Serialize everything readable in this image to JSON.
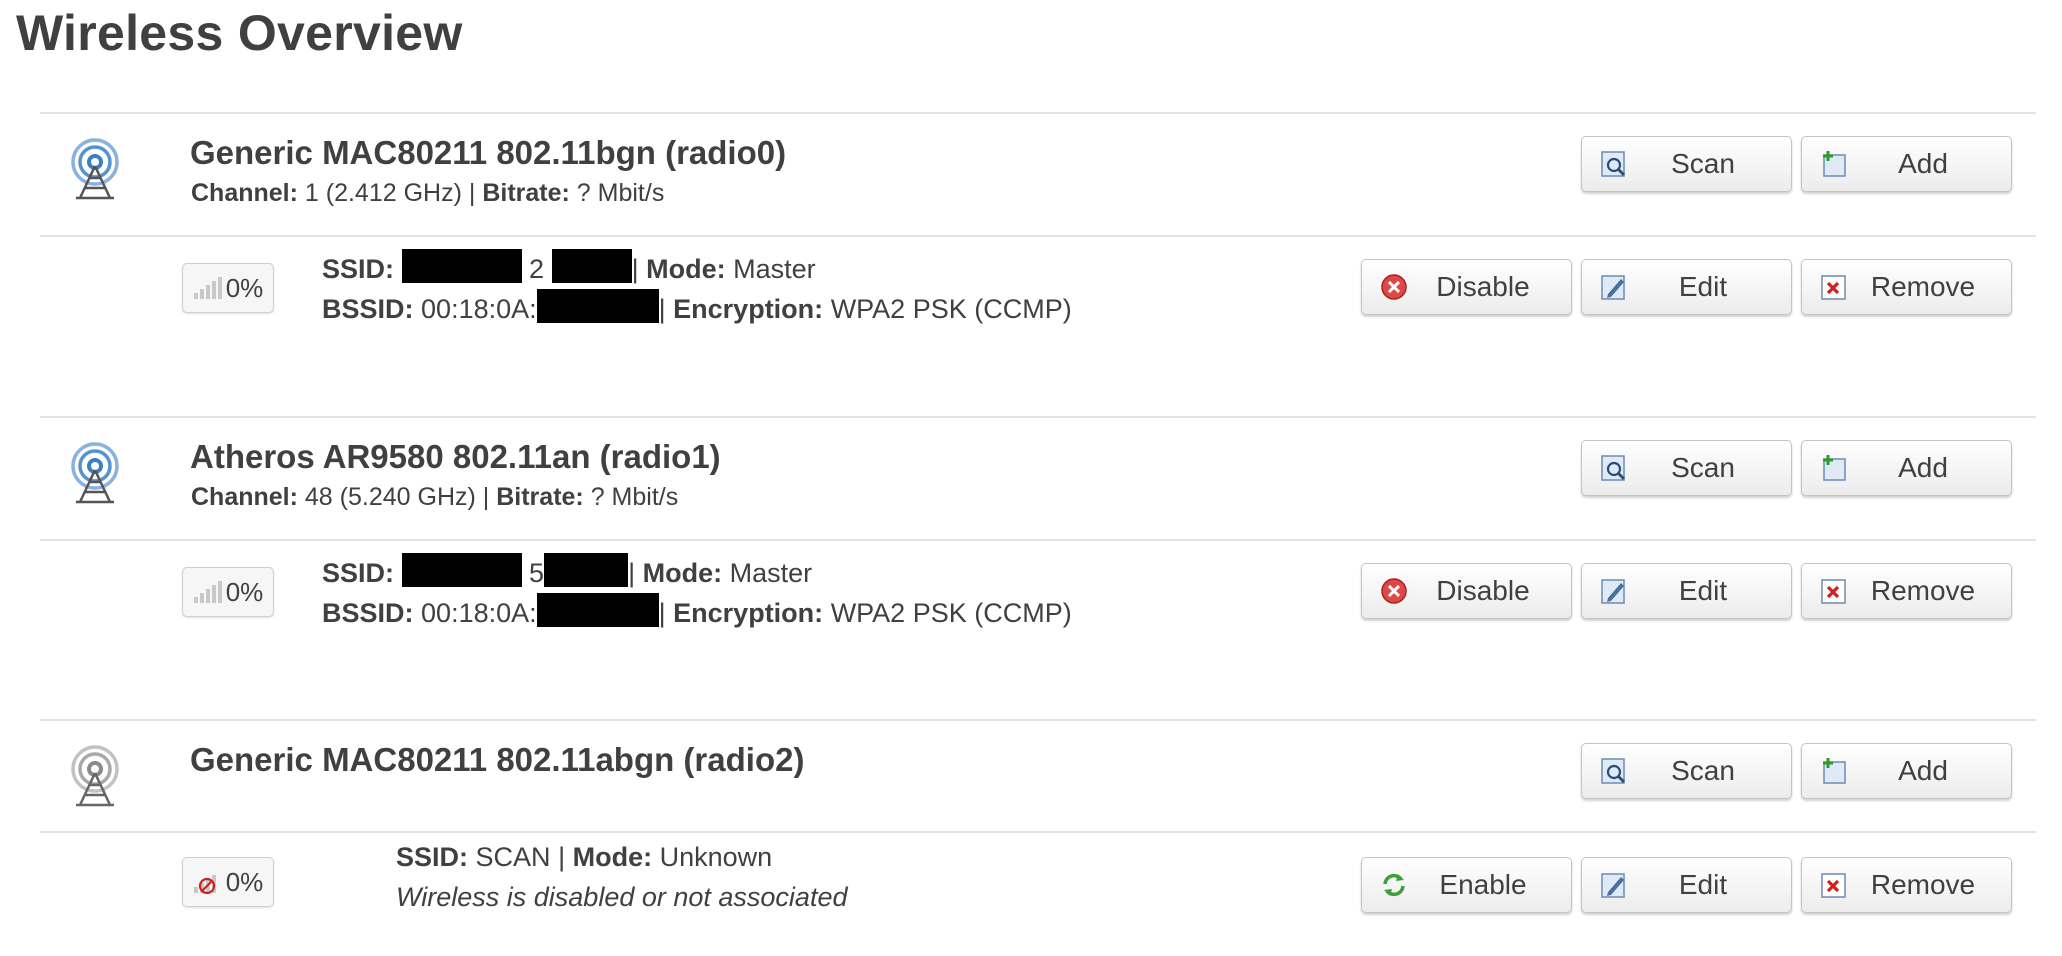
{
  "page_title": "Wireless Overview",
  "labels": {
    "channel": "Channel:",
    "bitrate": "Bitrate:",
    "ssid": "SSID:",
    "mode": "Mode:",
    "bssid": "BSSID:",
    "encryption": "Encryption:",
    "sep": "|"
  },
  "buttons": {
    "scan": "Scan",
    "add": "Add",
    "disable": "Disable",
    "enable": "Enable",
    "edit": "Edit",
    "remove": "Remove"
  },
  "radios": [
    {
      "name": "Generic MAC80211 802.11bgn (radio0)",
      "channel": "1 (2.412 GHz)",
      "bitrate": "? Mbit/s",
      "icon": "wifi-radio-icon-active",
      "network": {
        "signal": "0%",
        "ssid_mid": "2",
        "mode": "Master",
        "bssid_prefix": "00:18:0A:",
        "encryption": "WPA2 PSK (CCMP)"
      }
    },
    {
      "name": "Atheros AR9580 802.11an (radio1)",
      "channel": "48 (5.240 GHz)",
      "bitrate": "? Mbit/s",
      "icon": "wifi-radio-icon-active",
      "network": {
        "signal": "0%",
        "ssid_mid": "5",
        "mode": "Master",
        "bssid_prefix": "00:18:0A:",
        "encryption": "WPA2 PSK (CCMP)"
      }
    },
    {
      "name": "Generic MAC80211 802.11abgn (radio2)",
      "icon": "wifi-radio-icon-inactive",
      "network": {
        "signal": "0%",
        "ssid": "SCAN",
        "mode": "Unknown",
        "status": "Wireless is disabled or not associated"
      }
    }
  ],
  "colors": {
    "active_radio": "#3a7fc8",
    "inactive_radio": "#9a9a9a",
    "text": "#404040",
    "divider": "#e2e2e2",
    "redaction": "#000000"
  }
}
